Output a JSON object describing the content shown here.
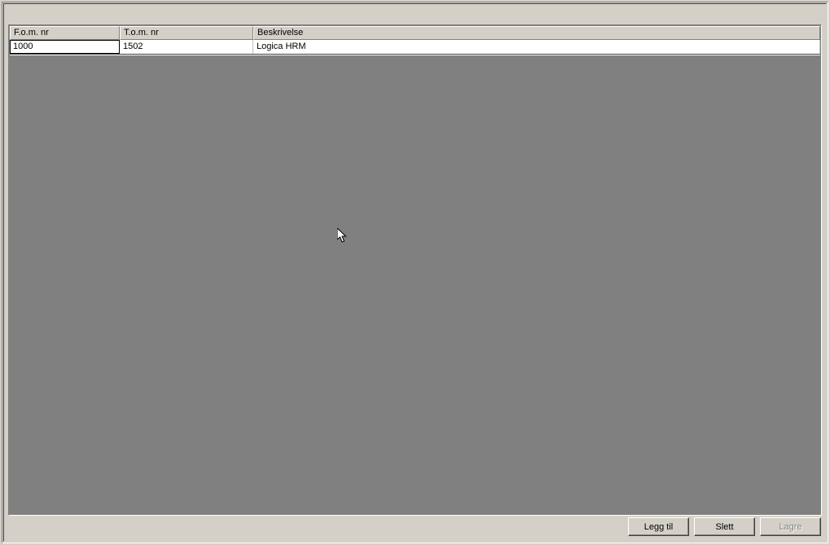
{
  "grid": {
    "headers": {
      "fom": "F.o.m. nr",
      "tom": "T.o.m. nr",
      "beskrivelse": "Beskrivelse"
    },
    "rows": [
      {
        "fom": "1000",
        "tom": "1502",
        "beskrivelse": "Logica HRM"
      }
    ]
  },
  "buttons": {
    "legg_til": "Legg til",
    "slett": "Slett",
    "lagre": "Lagre"
  }
}
